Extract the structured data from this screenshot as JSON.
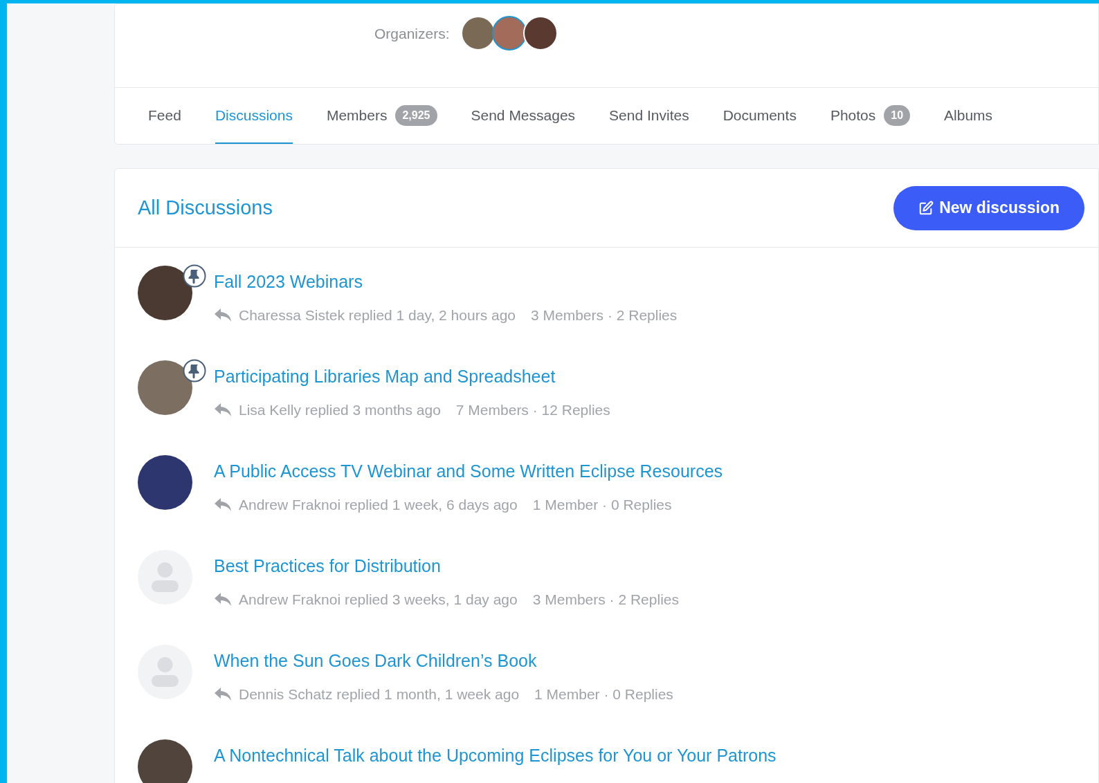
{
  "header": {
    "organizers_label": "Organizers:",
    "organizers": [
      {
        "kind": "photo"
      },
      {
        "kind": "photo"
      },
      {
        "kind": "photo"
      }
    ]
  },
  "tabs": [
    {
      "label": "Feed",
      "selected": false
    },
    {
      "label": "Discussions",
      "selected": true
    },
    {
      "label": "Members",
      "count": "2,925",
      "selected": false
    },
    {
      "label": "Send Messages",
      "selected": false
    },
    {
      "label": "Send Invites",
      "selected": false
    },
    {
      "label": "Documents",
      "selected": false
    },
    {
      "label": "Photos",
      "count": "10",
      "selected": false
    },
    {
      "label": "Albums",
      "selected": false
    }
  ],
  "discussions_panel": {
    "title": "All Discussions",
    "new_button": "New discussion",
    "items": [
      {
        "title": "Fall 2023 Webinars",
        "kind": "photo",
        "pinned": true,
        "reply": "Charessa Sistek replied 1 day, 2 hours ago",
        "stats": "3 Members · 2 Replies"
      },
      {
        "title": "Participating Libraries Map and Spreadsheet",
        "kind": "photo",
        "pinned": true,
        "reply": "Lisa Kelly replied 3 months ago",
        "stats": "7 Members · 12 Replies"
      },
      {
        "title": "A Public Access TV Webinar and Some Written Eclipse Resources",
        "kind": "photo",
        "pinned": false,
        "reply": "Andrew Fraknoi replied 1 week, 6 days ago",
        "stats": "1 Member · 0 Replies"
      },
      {
        "title": "Best Practices for Distribution",
        "kind": "default",
        "pinned": false,
        "reply": "Andrew Fraknoi replied 3 weeks, 1 day ago",
        "stats": "3 Members · 2 Replies"
      },
      {
        "title": "When the Sun Goes Dark Children’s Book",
        "kind": "default",
        "pinned": false,
        "reply": "Dennis Schatz replied 1 month, 1 week ago",
        "stats": "1 Member · 0 Replies"
      },
      {
        "title": "A Nontechnical Talk about the Upcoming Eclipses for You or Your Patrons",
        "kind": "photo",
        "pinned": false
      }
    ]
  }
}
